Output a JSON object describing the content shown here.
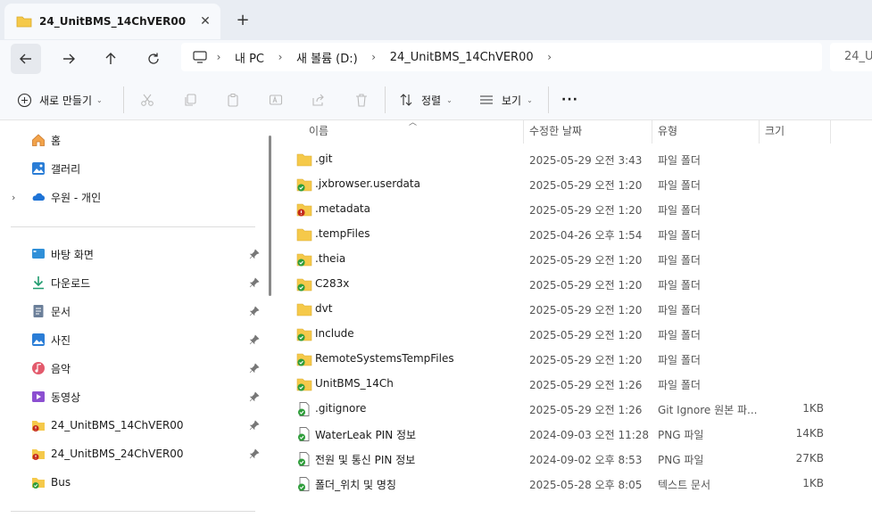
{
  "tab": {
    "title": "24_UnitBMS_14ChVER00",
    "close": "✕",
    "new_tab": "+"
  },
  "address": {
    "crumbs": [
      "내 PC",
      "새 볼륨 (D:)",
      "24_UnitBMS_14ChVER00"
    ],
    "search_text": "24_Ur"
  },
  "toolbar": {
    "new_label": "새로 만들기",
    "sort_label": "정렬",
    "view_label": "보기",
    "more": "···"
  },
  "sidebar": {
    "top": [
      {
        "label": "홈",
        "icon": "home-icon"
      },
      {
        "label": "갤러리",
        "icon": "gallery-icon"
      },
      {
        "label": "우원 - 개인",
        "icon": "onedrive-cloud-icon"
      }
    ],
    "quick": [
      {
        "label": "바탕 화면",
        "icon": "desktop-icon"
      },
      {
        "label": "다운로드",
        "icon": "download-icon"
      },
      {
        "label": "문서",
        "icon": "documents-icon"
      },
      {
        "label": "사진",
        "icon": "pictures-icon"
      },
      {
        "label": "음악",
        "icon": "music-icon"
      },
      {
        "label": "동영상",
        "icon": "videos-icon"
      },
      {
        "label": "24_UnitBMS_14ChVER00",
        "icon": "folder-error-icon"
      },
      {
        "label": "24_UnitBMS_24ChVER00",
        "icon": "folder-error-icon"
      },
      {
        "label": "Bus",
        "icon": "folder-synced-icon"
      }
    ]
  },
  "columns": {
    "name": "이름",
    "date": "수정한 날짜",
    "type": "유형",
    "size": "크기"
  },
  "files": [
    {
      "name": ".git",
      "date": "2025-05-29 오전 3:43",
      "type": "파일 폴더",
      "size": "",
      "icon": "folder-plain"
    },
    {
      "name": ".jxbrowser.userdata",
      "date": "2025-05-29 오전 1:20",
      "type": "파일 폴더",
      "size": "",
      "icon": "folder-synced"
    },
    {
      "name": ".metadata",
      "date": "2025-05-29 오전 1:20",
      "type": "파일 폴더",
      "size": "",
      "icon": "folder-error"
    },
    {
      "name": ".tempFiles",
      "date": "2025-04-26 오후 1:54",
      "type": "파일 폴더",
      "size": "",
      "icon": "folder-plain"
    },
    {
      "name": ".theia",
      "date": "2025-05-29 오전 1:20",
      "type": "파일 폴더",
      "size": "",
      "icon": "folder-synced"
    },
    {
      "name": "C283x",
      "date": "2025-05-29 오전 1:20",
      "type": "파일 폴더",
      "size": "",
      "icon": "folder-synced"
    },
    {
      "name": "dvt",
      "date": "2025-05-29 오전 1:20",
      "type": "파일 폴더",
      "size": "",
      "icon": "folder-plain"
    },
    {
      "name": "Include",
      "date": "2025-05-29 오전 1:20",
      "type": "파일 폴더",
      "size": "",
      "icon": "folder-synced"
    },
    {
      "name": "RemoteSystemsTempFiles",
      "date": "2025-05-29 오전 1:20",
      "type": "파일 폴더",
      "size": "",
      "icon": "folder-synced"
    },
    {
      "name": "UnitBMS_14Ch",
      "date": "2025-05-29 오전 1:26",
      "type": "파일 폴더",
      "size": "",
      "icon": "folder-synced"
    },
    {
      "name": ".gitignore",
      "date": "2025-05-29 오전 1:26",
      "type": "Git Ignore 원본 파...",
      "size": "1KB",
      "icon": "file-synced"
    },
    {
      "name": "WaterLeak PIN 정보",
      "date": "2024-09-03 오전 11:28",
      "type": "PNG 파일",
      "size": "14KB",
      "icon": "file-synced"
    },
    {
      "name": "전원 및 통신 PIN 정보",
      "date": "2024-09-02 오후 8:53",
      "type": "PNG 파일",
      "size": "27KB",
      "icon": "file-synced"
    },
    {
      "name": "폴더_위치 및 명칭",
      "date": "2025-05-28 오후 8:05",
      "type": "텍스트 문서",
      "size": "1KB",
      "icon": "file-synced"
    }
  ],
  "colors": {
    "folder": "#f5c94a",
    "sync_green": "#2e9d3a",
    "error_red": "#c42b1c",
    "accent": "#0067c0"
  }
}
